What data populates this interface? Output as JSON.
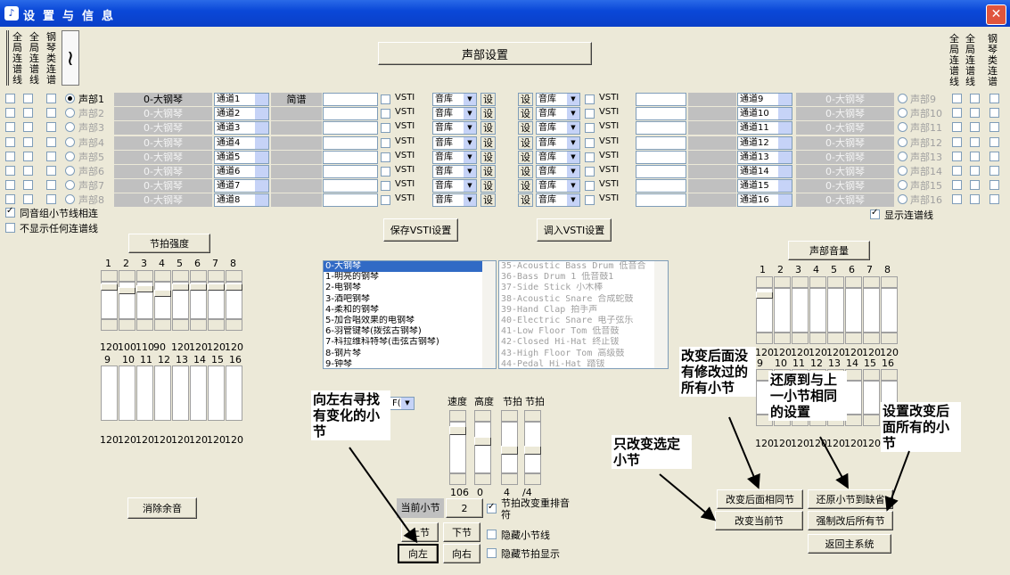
{
  "window": {
    "title": "设置与信息",
    "close_glyph": "✕",
    "app_icon": "music-app-icon"
  },
  "left_top_labels": {
    "global1": "全局连谱线",
    "global2": "全局连谱线",
    "piano": "钢琴类连谱"
  },
  "right_top_labels": {
    "global1": "全局连谱线",
    "global2": "全局连谱线",
    "piano": "钢琴类连谱"
  },
  "voice_settings_button": "声部设置",
  "left_voices": [
    {
      "voice": "声部1",
      "instrument": "0-大钢琴",
      "channel": "通道1",
      "mode": "简谱"
    },
    {
      "voice": "声部2",
      "instrument": "0-大钢琴",
      "channel": "通道2",
      "mode": ""
    },
    {
      "voice": "声部3",
      "instrument": "0-大钢琴",
      "channel": "通道3",
      "mode": ""
    },
    {
      "voice": "声部4",
      "instrument": "0-大钢琴",
      "channel": "通道4",
      "mode": ""
    },
    {
      "voice": "声部5",
      "instrument": "0-大钢琴",
      "channel": "通道5",
      "mode": ""
    },
    {
      "voice": "声部6",
      "instrument": "0-大钢琴",
      "channel": "通道6",
      "mode": ""
    },
    {
      "voice": "声部7",
      "instrument": "0-大钢琴",
      "channel": "通道7",
      "mode": ""
    },
    {
      "voice": "声部8",
      "instrument": "0-大钢琴",
      "channel": "通道8",
      "mode": ""
    }
  ],
  "right_voices": [
    {
      "voice": "声部9",
      "instrument": "0-大钢琴",
      "channel": "通道9"
    },
    {
      "voice": "声部10",
      "instrument": "0-大钢琴",
      "channel": "通道10"
    },
    {
      "voice": "声部11",
      "instrument": "0-大钢琴",
      "channel": "通道11"
    },
    {
      "voice": "声部12",
      "instrument": "0-大钢琴",
      "channel": "通道12"
    },
    {
      "voice": "声部13",
      "instrument": "0-大钢琴",
      "channel": "通道13"
    },
    {
      "voice": "声部14",
      "instrument": "0-大钢琴",
      "channel": "通道14"
    },
    {
      "voice": "声部15",
      "instrument": "0-大钢琴",
      "channel": "通道15"
    },
    {
      "voice": "声部16",
      "instrument": "0-大钢琴",
      "channel": "通道16"
    }
  ],
  "vsti_label": "VSTI",
  "sound_lib": "音库",
  "set_label": "设",
  "same_group_barline": "同音组小节线相连",
  "no_connect": "不显示任何连谱线",
  "show_connect": "显示连谱线",
  "save_vsti": "保存VSTI设置",
  "load_vsti": "调入VSTI设置",
  "beat_strength": {
    "title": "节拍强度",
    "top_nums": [
      "1",
      "2",
      "3",
      "4",
      "5",
      "6",
      "7",
      "8"
    ],
    "top_values": [
      "120",
      "100",
      "110",
      "90",
      "120",
      "120",
      "120",
      "120"
    ],
    "bottom_nums": [
      "9",
      "10",
      "11",
      "12",
      "13",
      "14",
      "15",
      "16"
    ],
    "bottom_values": [
      "120",
      "120",
      "120",
      "120",
      "120",
      "120",
      "120",
      "120"
    ]
  },
  "voice_volume": {
    "title": "声部音量",
    "top_nums": [
      "1",
      "2",
      "3",
      "4",
      "5",
      "6",
      "7",
      "8"
    ],
    "top_values": [
      "120",
      "120",
      "120",
      "120",
      "120",
      "120",
      "120",
      "120"
    ],
    "bottom_nums": [
      "9",
      "10",
      "11",
      "12",
      "13",
      "14",
      "15",
      "16"
    ],
    "bottom_values": [
      "120",
      "120",
      "120",
      "120",
      "120",
      "120",
      "120",
      "120"
    ]
  },
  "instrument_list": [
    "0-大钢琴",
    "1-明亮的钢琴",
    "2-电钢琴",
    "3-酒吧钢琴",
    "4-柔和的钢琴",
    "5-加合唱效果的电钢琴",
    "6-羽管键琴(拨弦古钢琴)",
    "7-科拉维科特琴(击弦古钢琴)",
    "8-钢片琴",
    "9-钟琴"
  ],
  "drum_list": [
    "35-Acoustic Bass Drum  低音合",
    "36-Bass Drum 1 低音鼓1",
    "37-Side Stick 小木棒",
    "38-Acoustic Snare 合成蛇鼓",
    "39-Hand Clap 拍手声",
    "40-Electric Snare 电子弦乐",
    "41-Low Floor Tom 低音鼓",
    "42-Closed Hi-Hat 终止钹",
    "43-High Floor Tom 高级鼓",
    "44-Pedal Hi-Hat 踏钹"
  ],
  "small_combo": "F(",
  "tempo_labels": {
    "speed": "速度",
    "height": "高度",
    "beat1": "节拍",
    "beat2": "节拍"
  },
  "tempo_values": {
    "speed": "106",
    "height": "0",
    "beat_num": "4",
    "beat_den": "/4"
  },
  "clear_reverb": "消除余音",
  "current_bar_label": "当前小节",
  "current_bar_value": "2",
  "beat_change_label": "节拍改变重排音符",
  "hide_bar_line": "隐藏小节线",
  "hide_beat": "隐藏节拍显示",
  "prev_bar": "上节",
  "next_bar": "下节",
  "to_left": "向左",
  "to_right": "向右",
  "change_after_same": "改变后面相同节",
  "restore_default": "还原小节到缺省",
  "change_current": "改变当前节",
  "force_change_all": "强制改后所有节",
  "return_main": "返回主系统",
  "annotations": {
    "search": "向左右寻找有变化的小节",
    "change_all_unmodified": "改变后面没有修改过的所有小节",
    "restore_same": "还原到与上一小节相同的设置",
    "change_selected": "只改变选定小节",
    "set_change_after": "设置改变后面所有的小节"
  }
}
